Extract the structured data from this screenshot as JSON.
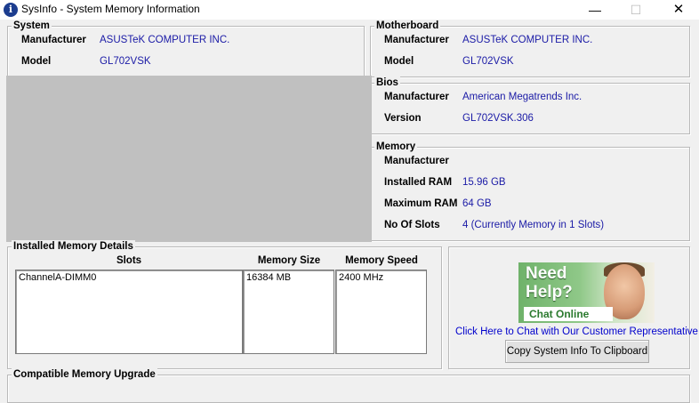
{
  "window": {
    "title": "SysInfo - System Memory Information"
  },
  "system": {
    "legend": "System",
    "manufacturer_label": "Manufacturer",
    "manufacturer": "ASUSTeK COMPUTER INC.",
    "model_label": "Model",
    "model": "GL702VSK"
  },
  "motherboard": {
    "legend": "Motherboard",
    "manufacturer_label": "Manufacturer",
    "manufacturer": "ASUSTeK COMPUTER INC.",
    "model_label": "Model",
    "model": "GL702VSK"
  },
  "bios": {
    "legend": "Bios",
    "manufacturer_label": "Manufacturer",
    "manufacturer": "American Megatrends Inc.",
    "version_label": "Version",
    "version": "GL702VSK.306"
  },
  "memory": {
    "legend": "Memory",
    "manufacturer_label": "Manufacturer",
    "manufacturer": "",
    "installed_label": "Installed RAM",
    "installed": "15.96 GB",
    "maximum_label": "Maximum RAM",
    "maximum": "64 GB",
    "slots_label": "No Of Slots",
    "slots": "4  (Currently Memory in 1 Slots)"
  },
  "installed_details": {
    "legend": "Installed Memory Details",
    "headers": [
      "Slots",
      "Memory Size",
      "Memory Speed"
    ],
    "rows": [
      {
        "slot": "ChannelA-DIMM0",
        "size": "16384 MB",
        "speed": "2400 MHz"
      }
    ]
  },
  "chat": {
    "banner_line1": "Need",
    "banner_line2": "Help?",
    "banner_line3": "Chat Online",
    "link": "Click Here to Chat with Our Customer Representative",
    "copy_button": "Copy System Info To Clipboard"
  },
  "compatible": {
    "legend": "Compatible Memory Upgrade"
  }
}
